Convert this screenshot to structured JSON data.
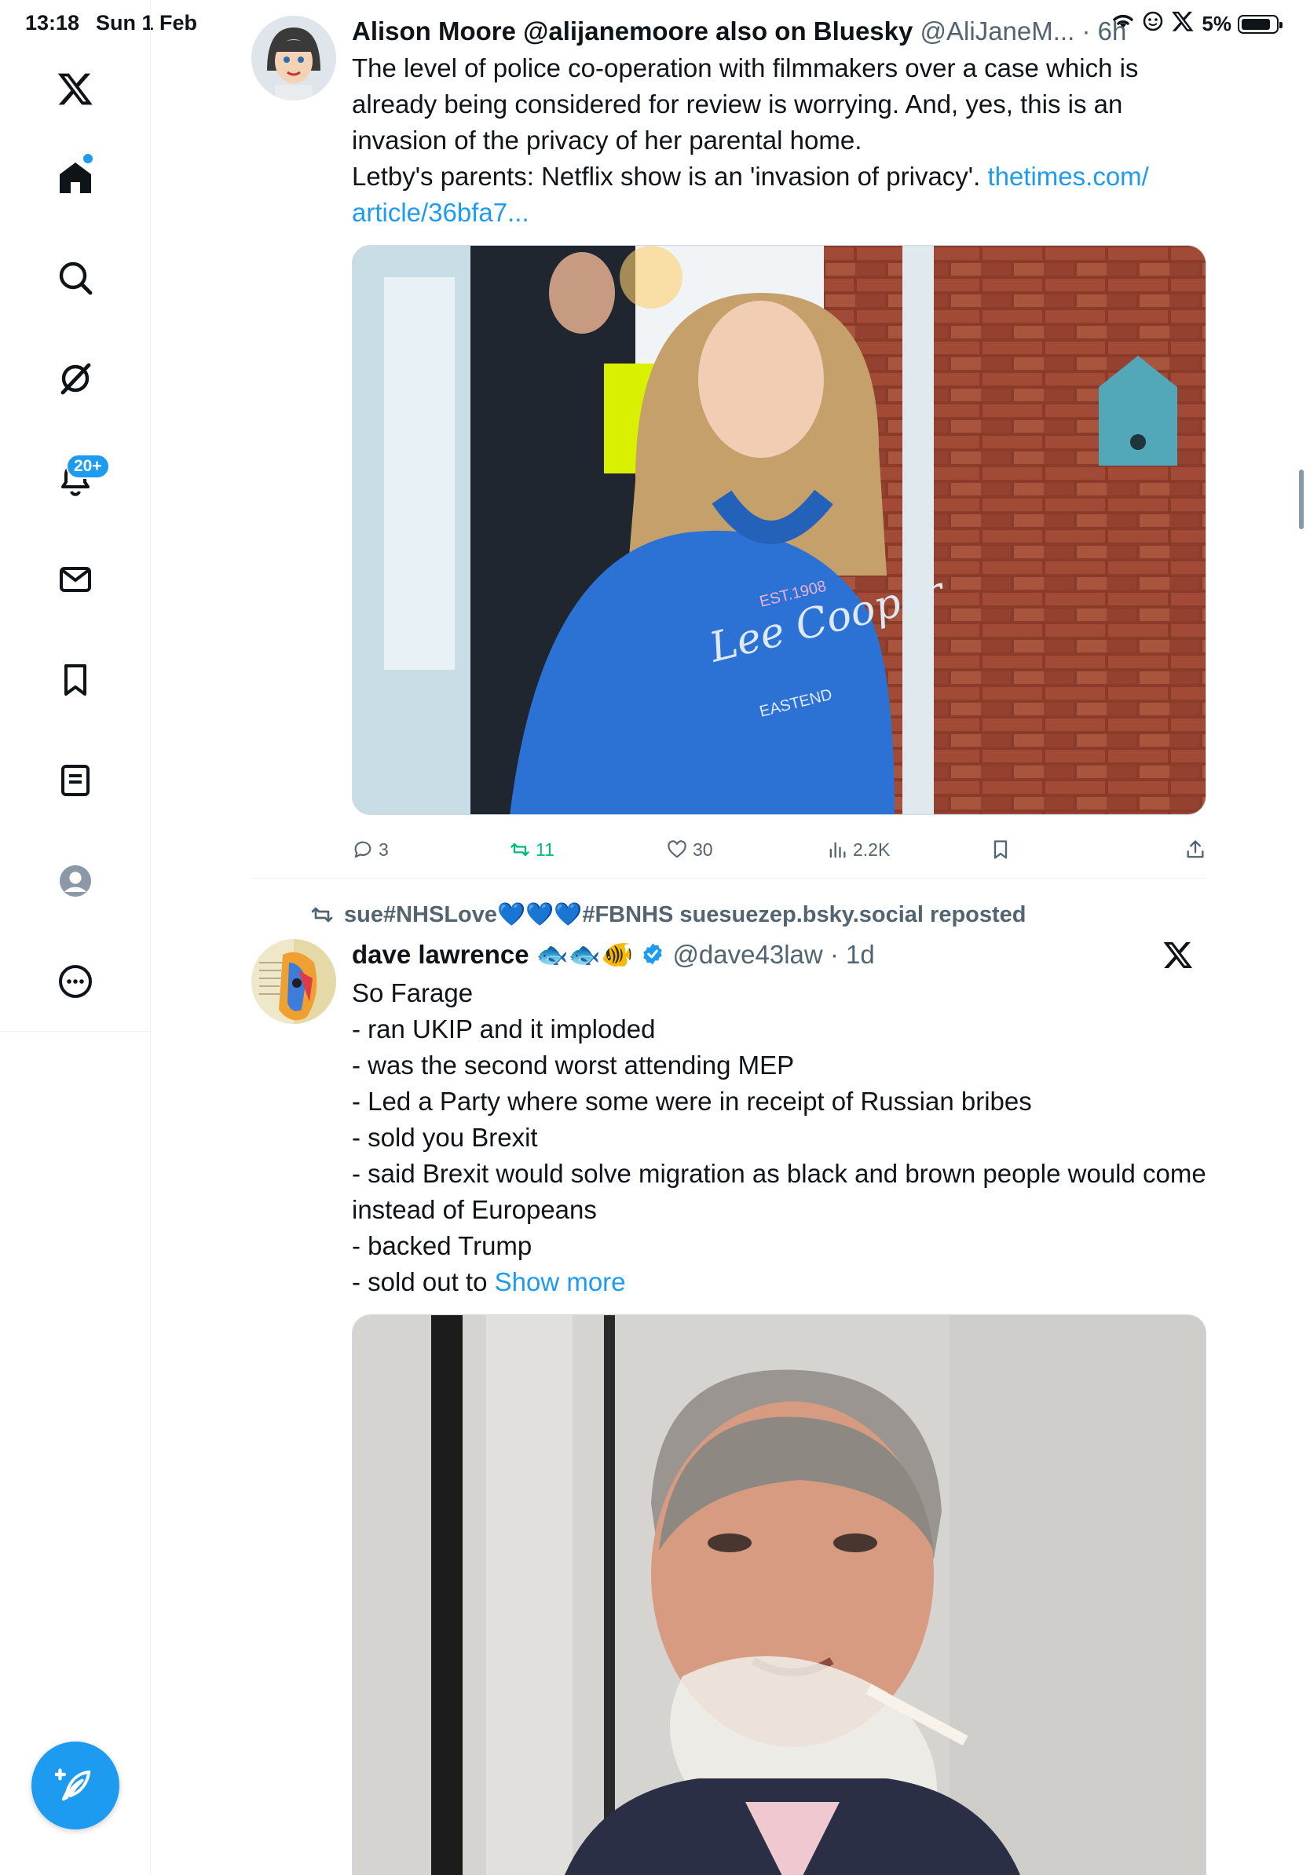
{
  "status_bar": {
    "time": "13:18",
    "date": "Sun 1 Feb",
    "battery": "5%",
    "battery_level": 0.85
  },
  "sidebar": {
    "notifications_badge": "20+",
    "items": [
      {
        "name": "x-logo",
        "icon": "x-logo-icon"
      },
      {
        "name": "home",
        "icon": "home-icon"
      },
      {
        "name": "explore",
        "icon": "search-icon"
      },
      {
        "name": "grok",
        "icon": "grok-icon"
      },
      {
        "name": "notifications",
        "icon": "bell-icon"
      },
      {
        "name": "messages",
        "icon": "envelope-icon"
      },
      {
        "name": "bookmarks",
        "icon": "bookmark-icon"
      },
      {
        "name": "lists",
        "icon": "list-icon"
      },
      {
        "name": "profile",
        "icon": "profile-icon"
      },
      {
        "name": "more",
        "icon": "more-icon"
      }
    ]
  },
  "tweets": [
    {
      "name": "Alison Moore @alijanemoore also on Bluesky",
      "handle": "@AliJaneM...",
      "time": "· 6h",
      "text": "The level of police co-operation with filmmakers over a case which is already being considered for review is worrying. And, yes, this is an invasion of the privacy of her parental home.\nLetby's parents: Netflix show is an 'invasion of privacy'. ",
      "link": "thetimes.com/\narticle/36bfa7...",
      "image_text": [
        "EST.1908",
        "Lee Cooper",
        "EASTEND"
      ],
      "replies": "3",
      "reposts": "11",
      "likes": "30",
      "views": "2.2K"
    },
    {
      "repost_by": "sue#NHSLove💙💙💙#FBNHS suesuezep.bsky.social reposted",
      "name": "dave lawrence",
      "name_emoji": "🐟🐟🐠",
      "handle": "@dave43law",
      "time": "· 1d",
      "text": "So Farage\n- ran UKIP and it imploded\n- was the second worst attending MEP\n- Led a Party where some were in receipt of Russian bribes\n- sold you Brexit\n- said Brexit would solve migration as black and brown people would come instead of Europeans\n- backed Trump\n- sold out to ",
      "show_more": "Show more"
    }
  ],
  "colors": {
    "accent": "#1d9bf0",
    "repost_green": "#00ba7c",
    "secondary_text": "#536471"
  }
}
